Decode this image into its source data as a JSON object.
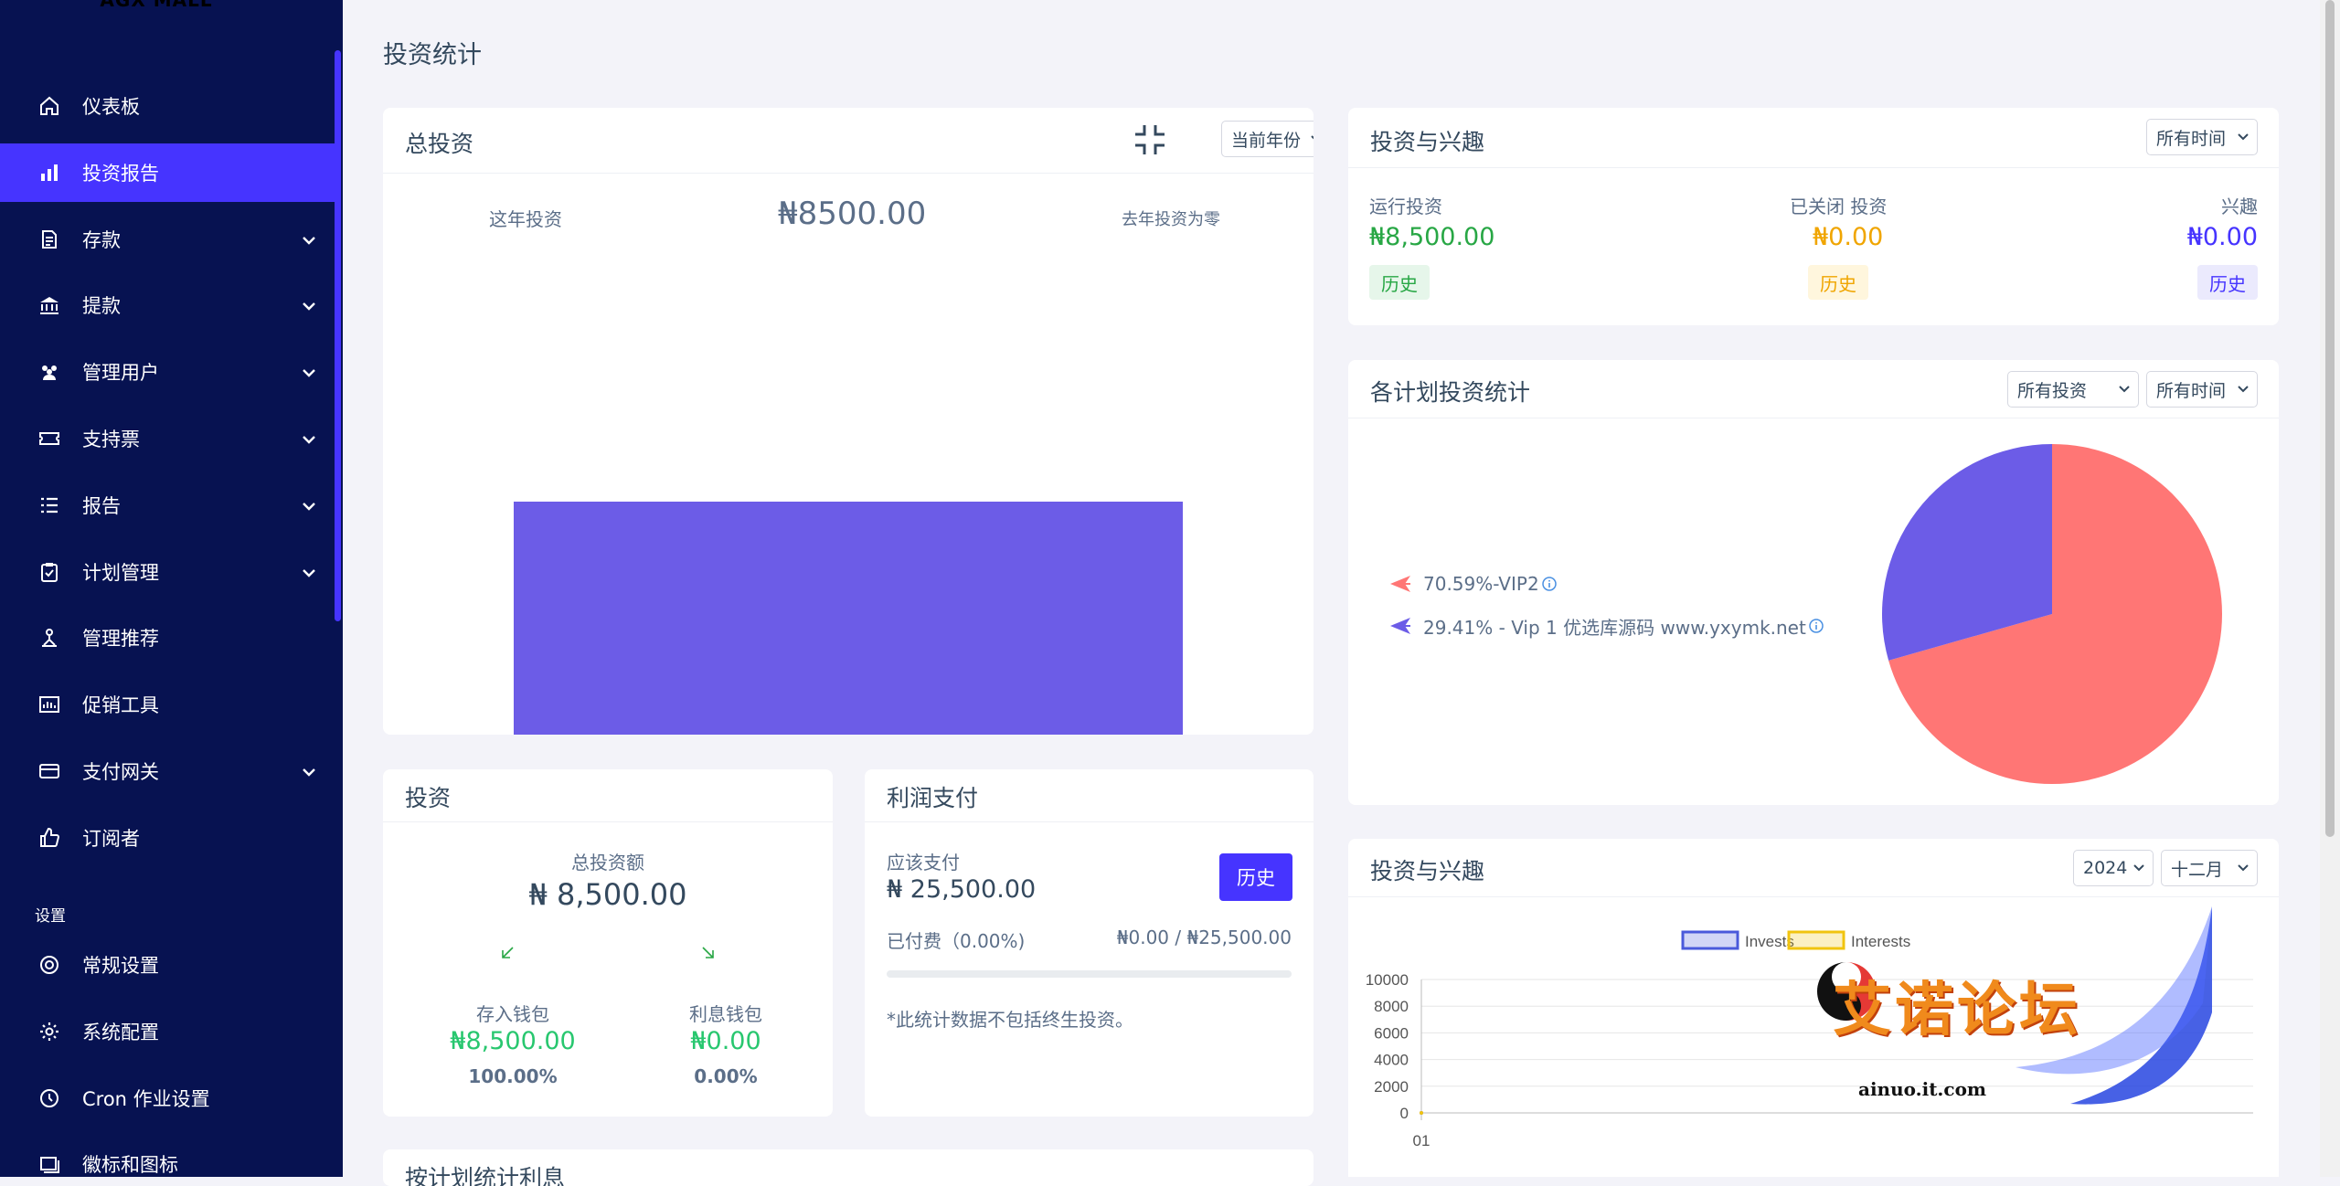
{
  "sidebar": {
    "logo": "AGX MALL",
    "items": [
      {
        "label": "仪表板",
        "icon": "home-icon",
        "has_arrow": false
      },
      {
        "label": "投资报告",
        "icon": "bar-chart-icon",
        "has_arrow": false,
        "active": true
      },
      {
        "label": "存款",
        "icon": "deposit-icon",
        "has_arrow": true
      },
      {
        "label": "提款",
        "icon": "bank-icon",
        "has_arrow": true
      },
      {
        "label": "管理用户",
        "icon": "users-icon",
        "has_arrow": true
      },
      {
        "label": "支持票",
        "icon": "ticket-icon",
        "has_arrow": true
      },
      {
        "label": "报告",
        "icon": "list-icon",
        "has_arrow": true
      },
      {
        "label": "计划管理",
        "icon": "clipboard-check-icon",
        "has_arrow": true
      },
      {
        "label": "管理推荐",
        "icon": "referral-tree-icon",
        "has_arrow": false
      },
      {
        "label": "促销工具",
        "icon": "promo-chart-icon",
        "has_arrow": false
      },
      {
        "label": "支付网关",
        "icon": "credit-card-icon",
        "has_arrow": true
      },
      {
        "label": "订阅者",
        "icon": "thumbs-up-icon",
        "has_arrow": false
      }
    ],
    "section_label": "设置",
    "settings_items": [
      {
        "label": "常规设置",
        "icon": "lifebuoy-icon"
      },
      {
        "label": "系统配置",
        "icon": "gear-icon"
      },
      {
        "label": "Cron 作业设置",
        "icon": "clock-icon"
      },
      {
        "label": "徽标和图标",
        "icon": "images-icon"
      }
    ]
  },
  "page": {
    "title": "投资统计"
  },
  "total_investment": {
    "title": "总投资",
    "select": "当前年份",
    "this_year_label": "这年投资",
    "amount": "₦8500.00",
    "last_year_note": "去年投资为零",
    "bar_fill_fraction": 0.63,
    "bar_color": "#6c5ce7"
  },
  "invest_interest": {
    "title": "投资与兴趣",
    "select": "所有时间",
    "running_label": "运行投资",
    "running_value": "₦8,500.00",
    "closed_label": "已关闭 投资",
    "closed_value": "₦0.00",
    "interest_label": "兴趣",
    "interest_value": "₦0.00",
    "history": "历史",
    "colors": {
      "green": "#28a745",
      "yellow": "#f0a500",
      "purple": "#4634ff"
    }
  },
  "plan_stats": {
    "title": "各计划投资统计",
    "select1": "所有投资",
    "select2": "所有时间",
    "legend": [
      {
        "label": "70.59%-VIP2",
        "color": "#ff7675"
      },
      {
        "label": "29.41% - Vip 1 优选库源码 www.yxymk.net",
        "color": "#6c5ce7"
      }
    ],
    "slices": [
      70.59,
      29.41
    ]
  },
  "investment_card": {
    "title": "投资",
    "total_label": "总投资额",
    "total_value": "₦ 8,500.00",
    "deposit_wallet_label": "存入钱包",
    "deposit_wallet_value": "₦8,500.00",
    "deposit_wallet_pct": "100.00%",
    "interest_wallet_label": "利息钱包",
    "interest_wallet_value": "₦0.00",
    "interest_wallet_pct": "0.00%"
  },
  "profit_payment": {
    "title": "利润支付",
    "due_label": "应该支付",
    "due_value": "₦ 25,500.00",
    "history": "历史",
    "paid_label": "已付费（0.00%)",
    "paid_ratio": "₦0.00 / ₦25,500.00",
    "progress": 0,
    "note": "*此统计数据不包括终生投资。"
  },
  "chart_card": {
    "title": "投资与兴趣",
    "year": "2024",
    "month": "十二月"
  },
  "chart_data": {
    "type": "line",
    "title": "",
    "series": [
      {
        "name": "Invests",
        "color": "#4a5adb",
        "values": [
          0
        ]
      },
      {
        "name": "Interests",
        "color": "#f1c40f",
        "values": [
          0
        ]
      }
    ],
    "x": [
      "01"
    ],
    "yticks": [
      0,
      2000,
      4000,
      6000,
      8000,
      10000
    ],
    "ylim": [
      0,
      10000
    ],
    "grid": true,
    "legend": "top"
  },
  "bottom_card": {
    "title": "按计划统计利息"
  },
  "watermark": {
    "text": "艾诺论坛",
    "url": "ainuo.it.com"
  }
}
